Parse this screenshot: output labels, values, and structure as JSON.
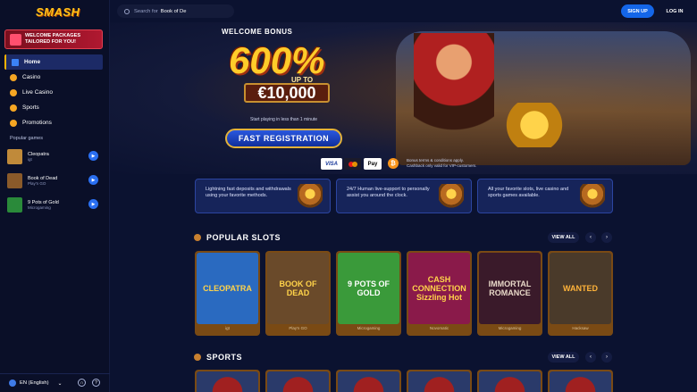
{
  "brand": {
    "logo": "SMASH"
  },
  "sidebar": {
    "promo": "WELCOME PACKAGES TAILORED FOR YOU!",
    "nav": [
      {
        "label": "Home",
        "icon": "home-icon",
        "color": "#3b82f6"
      },
      {
        "label": "Casino",
        "icon": "casino-icon",
        "color": "#f5a623"
      },
      {
        "label": "Live Casino",
        "icon": "live-casino-icon",
        "color": "#f5a623"
      },
      {
        "label": "Sports",
        "icon": "sports-icon",
        "color": "#f5a623"
      },
      {
        "label": "Promotions",
        "icon": "promotions-icon",
        "color": "#f5a623"
      }
    ],
    "popular_title": "Popular games",
    "popular": [
      {
        "name": "Cleopatra",
        "provider": "igt",
        "color": "#c08a3a"
      },
      {
        "name": "Book of Dead",
        "provider": "Play'n GO",
        "color": "#8a5a2a"
      },
      {
        "name": "9 Pots of Gold",
        "provider": "Microgaming",
        "color": "#2a8a3a"
      }
    ],
    "language": "EN (English)"
  },
  "topbar": {
    "search_placeholder": "Search for",
    "search_value": "Book of De",
    "signup": "SIGN UP",
    "login": "LOG IN"
  },
  "hero": {
    "welcome": "WELCOME BONUS",
    "percent": "600%",
    "upto": "UP TO",
    "amount": "€10,000",
    "play_min": "Start playing in less than 1 minute",
    "cta": "FAST REGISTRATION",
    "payments": {
      "visa": "VISA",
      "apple": "Pay",
      "btc": "₿"
    },
    "terms_line1": "Bonus terms & conditions apply.",
    "terms_line2": "Cashback only valid for VIP-customers."
  },
  "features": [
    "Lightning fast deposits and withdrawals using your favorite methods.",
    "24/7 Human live-support to personally assist you around the clock.",
    "All your favorite slots, live casino and sports games available."
  ],
  "popular_slots": {
    "title": "POPULAR SLOTS",
    "view_all": "VIEW ALL",
    "games": [
      {
        "title": "CLEOPATRA",
        "provider": "igt",
        "color": "#2a6ac0"
      },
      {
        "title": "BOOK OF DEAD",
        "provider": "Play'n GO",
        "color": "#6a4a2a"
      },
      {
        "title": "9 POTS OF GOLD",
        "provider": "Microgaming",
        "color": "#3a9a3a"
      },
      {
        "title": "CASH CONNECTION Sizzling Hot",
        "provider": "Novomatic",
        "color": "#8a1a4a"
      },
      {
        "title": "IMMORTAL ROMANCE",
        "provider": "Microgaming",
        "color": "#3a1a2a"
      },
      {
        "title": "WANTED",
        "provider": "Hacksaw",
        "color": "#4a3a2a"
      }
    ]
  },
  "sports": {
    "title": "SPORTS",
    "view_all": "VIEW ALL"
  }
}
